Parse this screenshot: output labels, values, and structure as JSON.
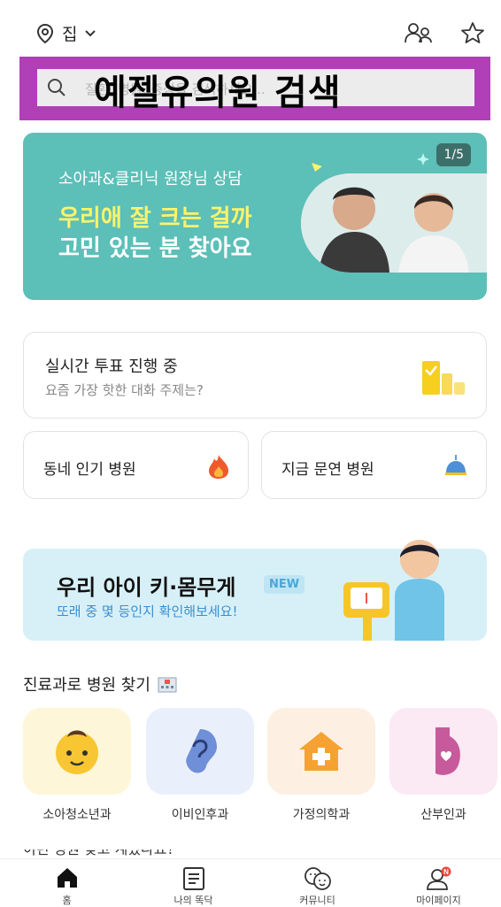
{
  "header": {
    "location": "집"
  },
  "search": {
    "label": "예젤유의원 검색",
    "ghost": "질환, 병원, 증상을 검색하세요..."
  },
  "banner": {
    "subtitle": "소아과&클리닉 원장님 상담",
    "line1": "우리애 잘 크는 걸까",
    "line2": "고민 있는 분 찾아요",
    "counter": "1/5"
  },
  "vote": {
    "title": "실시간 투표 진행 중",
    "subtitle": "요즘 가장 핫한 대화 주제는?"
  },
  "quick": {
    "popular": "동네 인기 병원",
    "open_now": "지금 문연 병원"
  },
  "kid": {
    "title": "우리 아이 키·몸무게",
    "badge": "NEW",
    "subtitle": "또래 중 몇 등인지 확인해보세요!"
  },
  "departments": {
    "title": "진료과로 병원 찾기",
    "items": [
      {
        "label": "소아청소년과",
        "bg": "#fdf6d8"
      },
      {
        "label": "이비인후과",
        "bg": "#eaf0fb"
      },
      {
        "label": "가정의학과",
        "bg": "#fdf0e2"
      },
      {
        "label": "산부인과",
        "bg": "#fbe9f3"
      }
    ]
  },
  "peek_text": "이런 병원 찾고 계셨나요?",
  "tabs": [
    {
      "label": "홈"
    },
    {
      "label": "나의 똑닥"
    },
    {
      "label": "커뮤니티"
    },
    {
      "label": "마이페이지"
    }
  ],
  "colors": {
    "accent": "#5cbfb8",
    "overlay": "#b13fb8",
    "notice": "#e8463a"
  }
}
